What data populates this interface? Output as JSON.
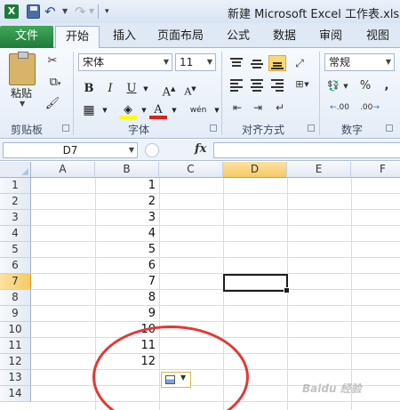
{
  "title_bar": {
    "app_logo": "X",
    "title": "新建 Microsoft Excel 工作表.xlsx -",
    "icons": [
      "excel-logo-icon",
      "save-icon",
      "undo-icon",
      "redo-icon",
      "customize-toolbar-icon"
    ]
  },
  "ribbon_tabs": [
    {
      "label": "文件",
      "active": false
    },
    {
      "label": "开始",
      "active": true
    },
    {
      "label": "插入",
      "active": false
    },
    {
      "label": "页面布局",
      "active": false
    },
    {
      "label": "公式",
      "active": false
    },
    {
      "label": "数据",
      "active": false
    },
    {
      "label": "审阅",
      "active": false
    },
    {
      "label": "视图",
      "active": false
    }
  ],
  "ribbon": {
    "clipboard": {
      "paste_label": "粘贴",
      "group_label": "剪贴板"
    },
    "font": {
      "font_name": "宋体",
      "font_size": "11",
      "bold": "B",
      "italic": "I",
      "underline": "U",
      "grow": "A",
      "shrink": "A",
      "font_color": "A",
      "phonetic": "wén",
      "group_label": "字体"
    },
    "alignment": {
      "group_label": "对齐方式"
    },
    "number": {
      "format": "常规",
      "percent": "%",
      "comma": ",",
      "inc_decimal": ".00",
      "dec_decimal": ".00",
      "group_label": "数字"
    }
  },
  "formula_bar": {
    "name_box": "D7",
    "fx": "fx",
    "formula": ""
  },
  "grid": {
    "columns": [
      "A",
      "B",
      "C",
      "D",
      "E",
      "F"
    ],
    "active_column": "D",
    "rows": [
      "1",
      "2",
      "3",
      "4",
      "5",
      "6",
      "7",
      "8",
      "9",
      "10",
      "11",
      "12",
      "13",
      "14"
    ],
    "active_row": "7",
    "active_cell": "D7",
    "column_b_values": [
      "1",
      "2",
      "3",
      "4",
      "5",
      "6",
      "7",
      "8",
      "9",
      "10",
      "11",
      "12"
    ]
  },
  "autofill_options": {
    "icon": "autofill-options-icon"
  },
  "annotation": {
    "color": "#e03a36"
  },
  "watermark": "Baidu 经验",
  "colors": {
    "file_tab": "#1f7a3a",
    "active_header": "#f6c966",
    "ribbon_bg": "#e4ecf7"
  }
}
